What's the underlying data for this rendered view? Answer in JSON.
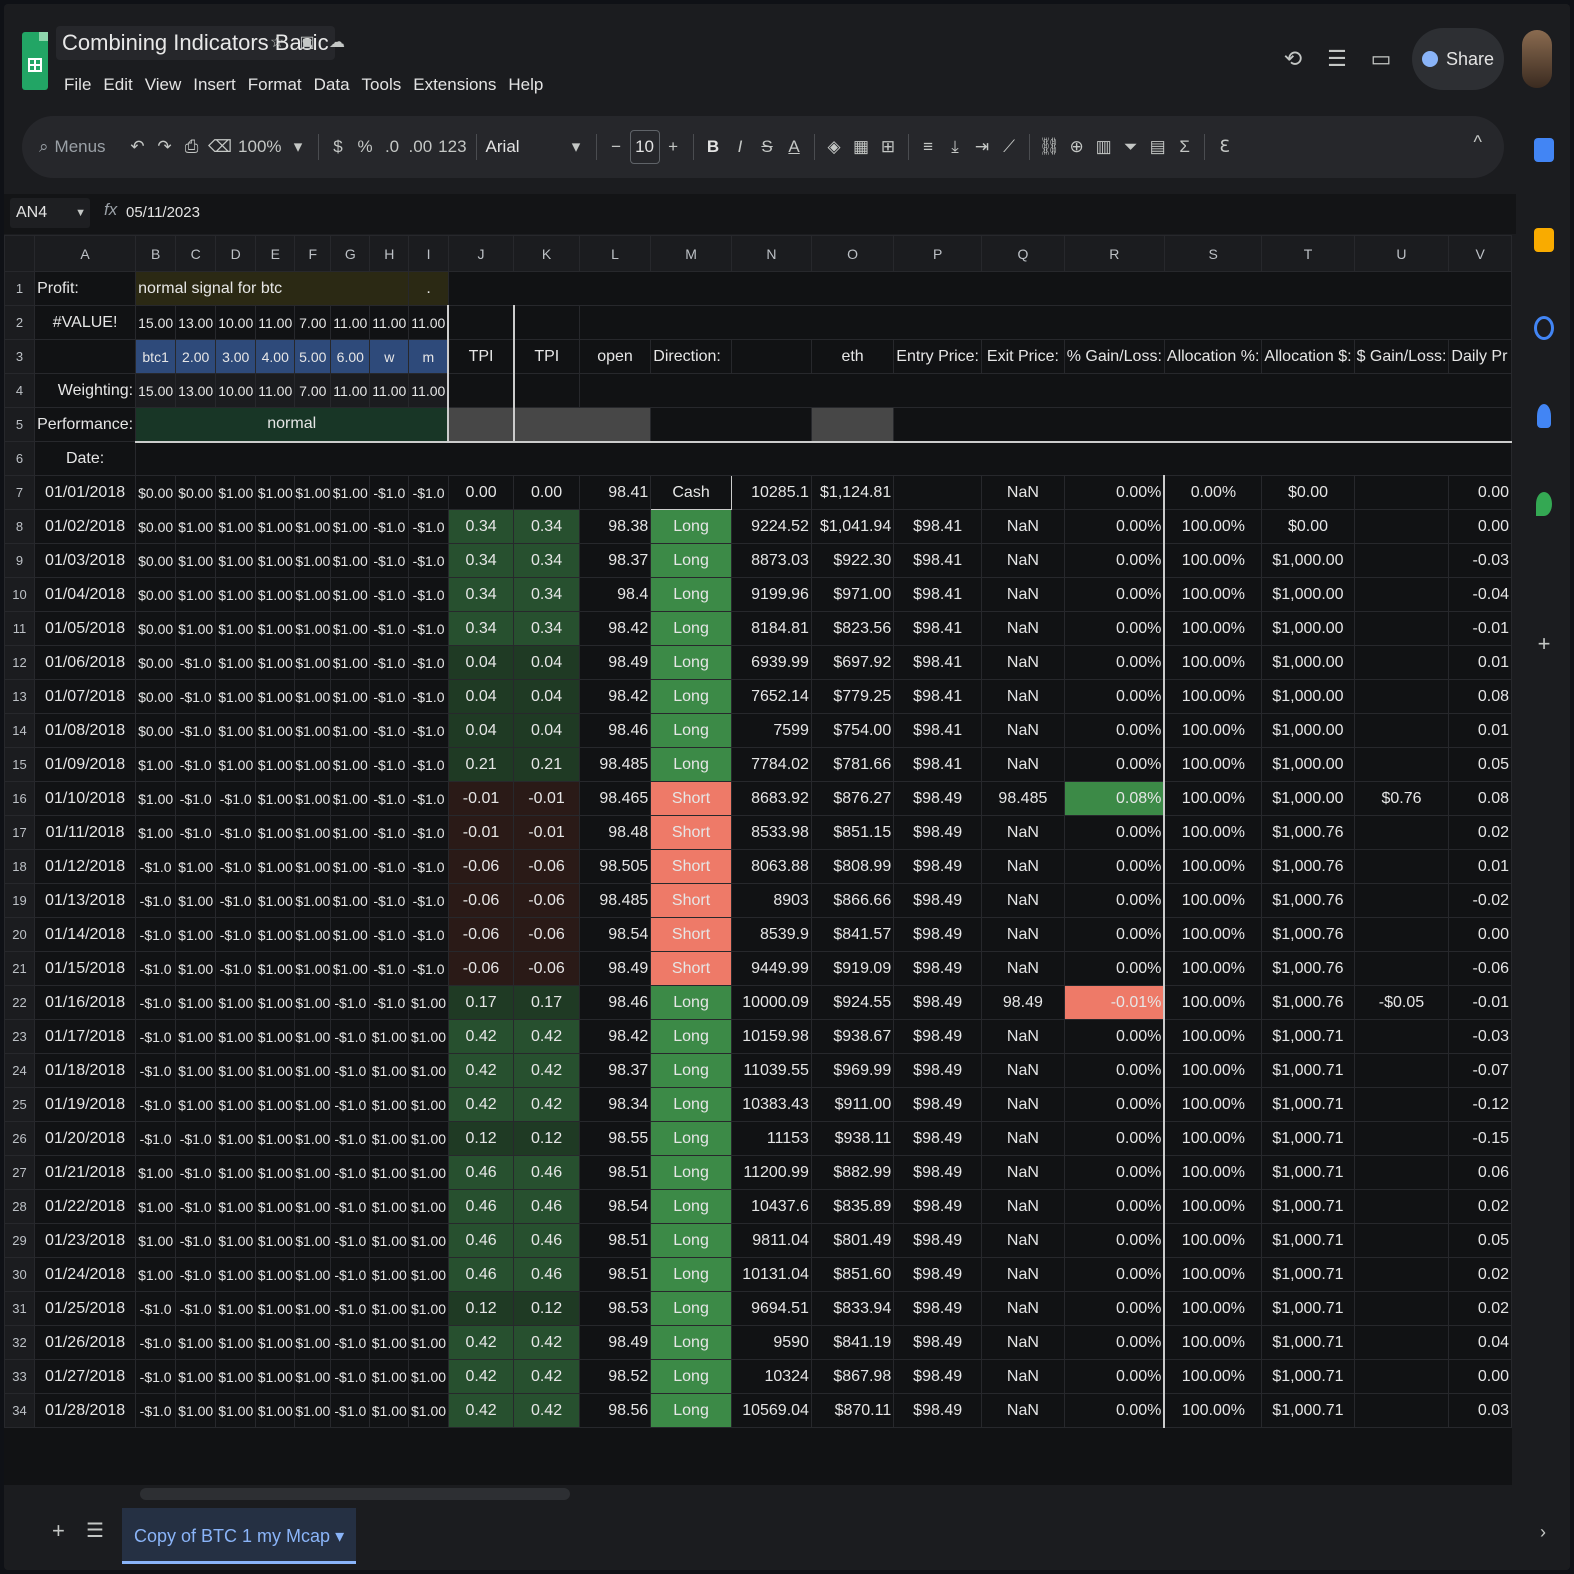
{
  "app": {
    "title": "Combining Indicators Basic",
    "menus": [
      "File",
      "Edit",
      "View",
      "Insert",
      "Format",
      "Data",
      "Tools",
      "Extensions",
      "Help"
    ],
    "share_label": "Share",
    "title_icons": [
      "star-icon",
      "move-folder-icon",
      "cloud-status-icon"
    ],
    "top_right_icons": [
      "history-icon",
      "comments-icon",
      "meet-icon"
    ]
  },
  "toolbar": {
    "search_placeholder": "Menus",
    "undo": "↶",
    "redo": "↷",
    "print": "⎙",
    "paint": "⌫",
    "zoom": "100%",
    "currency": "$",
    "percent": "%",
    "dec_less": ".0",
    "dec_more": ".00",
    "number_format": "123",
    "font": "Arial",
    "minus": "−",
    "font_size": "10",
    "plus": "+",
    "bold": "B",
    "italic": "I",
    "strike": "S",
    "text_color": "A",
    "collapse": "^"
  },
  "formula_bar": {
    "cell_ref": "AN4",
    "fx": "fx",
    "value": "05/11/2023"
  },
  "columns": [
    "A",
    "B",
    "C",
    "D",
    "E",
    "F",
    "G",
    "H",
    "I",
    "J",
    "K",
    "L",
    "M",
    "N",
    "O",
    "P",
    "Q",
    "R",
    "S",
    "T",
    "U",
    "V"
  ],
  "header_rows": {
    "r1": {
      "a": "Profit:",
      "b": "normal signal for btc",
      "i": "."
    },
    "r2": {
      "a": "#VALUE!",
      "vals": [
        "15.00",
        "13.00",
        "10.00",
        "11.00",
        "7.00",
        "11.00",
        "11.00",
        "11.00"
      ]
    },
    "r3": {
      "vals": [
        "btc1",
        "2.00",
        "3.00",
        "4.00",
        "5.00",
        "6.00",
        "w",
        "m"
      ],
      "j": "TPI",
      "k": "TPI",
      "l": "open",
      "m": "Direction:",
      "o": "eth",
      "p": "Entry Price:",
      "q": "Exit Price:",
      "r": "% Gain/Loss:",
      "s": "Allocation %:",
      "t": "Allocation $:",
      "u": "$ Gain/Loss:",
      "v": "Daily Pr"
    },
    "r4": {
      "a": "Weighting:",
      "vals": [
        "15.00",
        "13.00",
        "10.00",
        "11.00",
        "7.00",
        "11.00",
        "11.00",
        "11.00"
      ]
    },
    "r5": {
      "a": "Performance:",
      "b": "normal"
    },
    "r6": {
      "a": "Date:"
    }
  },
  "rows": [
    {
      "n": "7",
      "date": "01/01/2018",
      "sig": [
        "$0.00",
        "$0.00",
        "$1.00",
        "$1.00",
        "$1.00",
        "$1.00",
        "-$1.0",
        "-$1.0"
      ],
      "j": "0.00",
      "k": "0.00",
      "l": "98.41",
      "m": "Cash",
      "n2": "10285.1",
      "o": "$1,124.81",
      "p": "",
      "q": "NaN",
      "r": "0.00%",
      "s": "0.00%",
      "t": "$0.00",
      "u": "",
      "v": "0.00"
    },
    {
      "n": "8",
      "date": "01/02/2018",
      "sig": [
        "$0.00",
        "$1.00",
        "$1.00",
        "$1.00",
        "$1.00",
        "$1.00",
        "-$1.0",
        "-$1.0"
      ],
      "j": "0.34",
      "k": "0.34",
      "l": "98.38",
      "m": "Long",
      "n2": "9224.52",
      "o": "$1,041.94",
      "p": "$98.41",
      "q": "NaN",
      "r": "0.00%",
      "s": "100.00%",
      "t": "$0.00",
      "u": "",
      "v": "0.00"
    },
    {
      "n": "9",
      "date": "01/03/2018",
      "sig": [
        "$0.00",
        "$1.00",
        "$1.00",
        "$1.00",
        "$1.00",
        "$1.00",
        "-$1.0",
        "-$1.0"
      ],
      "j": "0.34",
      "k": "0.34",
      "l": "98.37",
      "m": "Long",
      "n2": "8873.03",
      "o": "$922.30",
      "p": "$98.41",
      "q": "NaN",
      "r": "0.00%",
      "s": "100.00%",
      "t": "$1,000.00",
      "u": "",
      "v": "-0.03"
    },
    {
      "n": "10",
      "date": "01/04/2018",
      "sig": [
        "$0.00",
        "$1.00",
        "$1.00",
        "$1.00",
        "$1.00",
        "$1.00",
        "-$1.0",
        "-$1.0"
      ],
      "j": "0.34",
      "k": "0.34",
      "l": "98.4",
      "m": "Long",
      "n2": "9199.96",
      "o": "$971.00",
      "p": "$98.41",
      "q": "NaN",
      "r": "0.00%",
      "s": "100.00%",
      "t": "$1,000.00",
      "u": "",
      "v": "-0.04"
    },
    {
      "n": "11",
      "date": "01/05/2018",
      "sig": [
        "$0.00",
        "$1.00",
        "$1.00",
        "$1.00",
        "$1.00",
        "$1.00",
        "-$1.0",
        "-$1.0"
      ],
      "j": "0.34",
      "k": "0.34",
      "l": "98.42",
      "m": "Long",
      "n2": "8184.81",
      "o": "$823.56",
      "p": "$98.41",
      "q": "NaN",
      "r": "0.00%",
      "s": "100.00%",
      "t": "$1,000.00",
      "u": "",
      "v": "-0.01"
    },
    {
      "n": "12",
      "date": "01/06/2018",
      "sig": [
        "$0.00",
        "-$1.0",
        "$1.00",
        "$1.00",
        "$1.00",
        "$1.00",
        "-$1.0",
        "-$1.0"
      ],
      "j": "0.04",
      "k": "0.04",
      "l": "98.49",
      "m": "Long",
      "n2": "6939.99",
      "o": "$697.92",
      "p": "$98.41",
      "q": "NaN",
      "r": "0.00%",
      "s": "100.00%",
      "t": "$1,000.00",
      "u": "",
      "v": "0.01"
    },
    {
      "n": "13",
      "date": "01/07/2018",
      "sig": [
        "$0.00",
        "-$1.0",
        "$1.00",
        "$1.00",
        "$1.00",
        "$1.00",
        "-$1.0",
        "-$1.0"
      ],
      "j": "0.04",
      "k": "0.04",
      "l": "98.42",
      "m": "Long",
      "n2": "7652.14",
      "o": "$779.25",
      "p": "$98.41",
      "q": "NaN",
      "r": "0.00%",
      "s": "100.00%",
      "t": "$1,000.00",
      "u": "",
      "v": "0.08"
    },
    {
      "n": "14",
      "date": "01/08/2018",
      "sig": [
        "$0.00",
        "-$1.0",
        "$1.00",
        "$1.00",
        "$1.00",
        "$1.00",
        "-$1.0",
        "-$1.0"
      ],
      "j": "0.04",
      "k": "0.04",
      "l": "98.46",
      "m": "Long",
      "n2": "7599",
      "o": "$754.00",
      "p": "$98.41",
      "q": "NaN",
      "r": "0.00%",
      "s": "100.00%",
      "t": "$1,000.00",
      "u": "",
      "v": "0.01"
    },
    {
      "n": "15",
      "date": "01/09/2018",
      "sig": [
        "$1.00",
        "-$1.0",
        "$1.00",
        "$1.00",
        "$1.00",
        "$1.00",
        "-$1.0",
        "-$1.0"
      ],
      "j": "0.21",
      "k": "0.21",
      "l": "98.485",
      "m": "Long",
      "n2": "7784.02",
      "o": "$781.66",
      "p": "$98.41",
      "q": "NaN",
      "r": "0.00%",
      "s": "100.00%",
      "t": "$1,000.00",
      "u": "",
      "v": "0.05"
    },
    {
      "n": "16",
      "date": "01/10/2018",
      "sig": [
        "$1.00",
        "-$1.0",
        "-$1.0",
        "$1.00",
        "$1.00",
        "$1.00",
        "-$1.0",
        "-$1.0"
      ],
      "j": "-0.01",
      "k": "-0.01",
      "l": "98.465",
      "m": "Short",
      "n2": "8683.92",
      "o": "$876.27",
      "p": "$98.49",
      "q": "98.485",
      "r": "0.08%",
      "s": "100.00%",
      "t": "$1,000.00",
      "u": "$0.76",
      "v": "0.08"
    },
    {
      "n": "17",
      "date": "01/11/2018",
      "sig": [
        "$1.00",
        "-$1.0",
        "-$1.0",
        "$1.00",
        "$1.00",
        "$1.00",
        "-$1.0",
        "-$1.0"
      ],
      "j": "-0.01",
      "k": "-0.01",
      "l": "98.48",
      "m": "Short",
      "n2": "8533.98",
      "o": "$851.15",
      "p": "$98.49",
      "q": "NaN",
      "r": "0.00%",
      "s": "100.00%",
      "t": "$1,000.76",
      "u": "",
      "v": "0.02"
    },
    {
      "n": "18",
      "date": "01/12/2018",
      "sig": [
        "-$1.0",
        "$1.00",
        "-$1.0",
        "$1.00",
        "$1.00",
        "$1.00",
        "-$1.0",
        "-$1.0"
      ],
      "j": "-0.06",
      "k": "-0.06",
      "l": "98.505",
      "m": "Short",
      "n2": "8063.88",
      "o": "$808.99",
      "p": "$98.49",
      "q": "NaN",
      "r": "0.00%",
      "s": "100.00%",
      "t": "$1,000.76",
      "u": "",
      "v": "0.01"
    },
    {
      "n": "19",
      "date": "01/13/2018",
      "sig": [
        "-$1.0",
        "$1.00",
        "-$1.0",
        "$1.00",
        "$1.00",
        "$1.00",
        "-$1.0",
        "-$1.0"
      ],
      "j": "-0.06",
      "k": "-0.06",
      "l": "98.485",
      "m": "Short",
      "n2": "8903",
      "o": "$866.66",
      "p": "$98.49",
      "q": "NaN",
      "r": "0.00%",
      "s": "100.00%",
      "t": "$1,000.76",
      "u": "",
      "v": "-0.02"
    },
    {
      "n": "20",
      "date": "01/14/2018",
      "sig": [
        "-$1.0",
        "$1.00",
        "-$1.0",
        "$1.00",
        "$1.00",
        "$1.00",
        "-$1.0",
        "-$1.0"
      ],
      "j": "-0.06",
      "k": "-0.06",
      "l": "98.54",
      "m": "Short",
      "n2": "8539.9",
      "o": "$841.57",
      "p": "$98.49",
      "q": "NaN",
      "r": "0.00%",
      "s": "100.00%",
      "t": "$1,000.76",
      "u": "",
      "v": "0.00"
    },
    {
      "n": "21",
      "date": "01/15/2018",
      "sig": [
        "-$1.0",
        "$1.00",
        "-$1.0",
        "$1.00",
        "$1.00",
        "$1.00",
        "-$1.0",
        "-$1.0"
      ],
      "j": "-0.06",
      "k": "-0.06",
      "l": "98.49",
      "m": "Short",
      "n2": "9449.99",
      "o": "$919.09",
      "p": "$98.49",
      "q": "NaN",
      "r": "0.00%",
      "s": "100.00%",
      "t": "$1,000.76",
      "u": "",
      "v": "-0.06"
    },
    {
      "n": "22",
      "date": "01/16/2018",
      "sig": [
        "-$1.0",
        "$1.00",
        "$1.00",
        "$1.00",
        "$1.00",
        "-$1.0",
        "-$1.0",
        "$1.00"
      ],
      "j": "0.17",
      "k": "0.17",
      "l": "98.46",
      "m": "Long",
      "n2": "10000.09",
      "o": "$924.55",
      "p": "$98.49",
      "q": "98.49",
      "r": "-0.01%",
      "s": "100.00%",
      "t": "$1,000.76",
      "u": "-$0.05",
      "v": "-0.01"
    },
    {
      "n": "23",
      "date": "01/17/2018",
      "sig": [
        "-$1.0",
        "$1.00",
        "$1.00",
        "$1.00",
        "$1.00",
        "-$1.0",
        "$1.00",
        "$1.00"
      ],
      "j": "0.42",
      "k": "0.42",
      "l": "98.42",
      "m": "Long",
      "n2": "10159.98",
      "o": "$938.67",
      "p": "$98.49",
      "q": "NaN",
      "r": "0.00%",
      "s": "100.00%",
      "t": "$1,000.71",
      "u": "",
      "v": "-0.03"
    },
    {
      "n": "24",
      "date": "01/18/2018",
      "sig": [
        "-$1.0",
        "$1.00",
        "$1.00",
        "$1.00",
        "$1.00",
        "-$1.0",
        "$1.00",
        "$1.00"
      ],
      "j": "0.42",
      "k": "0.42",
      "l": "98.37",
      "m": "Long",
      "n2": "11039.55",
      "o": "$969.99",
      "p": "$98.49",
      "q": "NaN",
      "r": "0.00%",
      "s": "100.00%",
      "t": "$1,000.71",
      "u": "",
      "v": "-0.07"
    },
    {
      "n": "25",
      "date": "01/19/2018",
      "sig": [
        "-$1.0",
        "$1.00",
        "$1.00",
        "$1.00",
        "$1.00",
        "-$1.0",
        "$1.00",
        "$1.00"
      ],
      "j": "0.42",
      "k": "0.42",
      "l": "98.34",
      "m": "Long",
      "n2": "10383.43",
      "o": "$911.00",
      "p": "$98.49",
      "q": "NaN",
      "r": "0.00%",
      "s": "100.00%",
      "t": "$1,000.71",
      "u": "",
      "v": "-0.12"
    },
    {
      "n": "26",
      "date": "01/20/2018",
      "sig": [
        "-$1.0",
        "-$1.0",
        "$1.00",
        "$1.00",
        "$1.00",
        "-$1.0",
        "$1.00",
        "$1.00"
      ],
      "j": "0.12",
      "k": "0.12",
      "l": "98.55",
      "m": "Long",
      "n2": "11153",
      "o": "$938.11",
      "p": "$98.49",
      "q": "NaN",
      "r": "0.00%",
      "s": "100.00%",
      "t": "$1,000.71",
      "u": "",
      "v": "-0.15"
    },
    {
      "n": "27",
      "date": "01/21/2018",
      "sig": [
        "$1.00",
        "-$1.0",
        "$1.00",
        "$1.00",
        "$1.00",
        "-$1.0",
        "$1.00",
        "$1.00"
      ],
      "j": "0.46",
      "k": "0.46",
      "l": "98.51",
      "m": "Long",
      "n2": "11200.99",
      "o": "$882.99",
      "p": "$98.49",
      "q": "NaN",
      "r": "0.00%",
      "s": "100.00%",
      "t": "$1,000.71",
      "u": "",
      "v": "0.06"
    },
    {
      "n": "28",
      "date": "01/22/2018",
      "sig": [
        "$1.00",
        "-$1.0",
        "$1.00",
        "$1.00",
        "$1.00",
        "-$1.0",
        "$1.00",
        "$1.00"
      ],
      "j": "0.46",
      "k": "0.46",
      "l": "98.54",
      "m": "Long",
      "n2": "10437.6",
      "o": "$835.89",
      "p": "$98.49",
      "q": "NaN",
      "r": "0.00%",
      "s": "100.00%",
      "t": "$1,000.71",
      "u": "",
      "v": "0.02"
    },
    {
      "n": "29",
      "date": "01/23/2018",
      "sig": [
        "$1.00",
        "-$1.0",
        "$1.00",
        "$1.00",
        "$1.00",
        "-$1.0",
        "$1.00",
        "$1.00"
      ],
      "j": "0.46",
      "k": "0.46",
      "l": "98.51",
      "m": "Long",
      "n2": "9811.04",
      "o": "$801.49",
      "p": "$98.49",
      "q": "NaN",
      "r": "0.00%",
      "s": "100.00%",
      "t": "$1,000.71",
      "u": "",
      "v": "0.05"
    },
    {
      "n": "30",
      "date": "01/24/2018",
      "sig": [
        "$1.00",
        "-$1.0",
        "$1.00",
        "$1.00",
        "$1.00",
        "-$1.0",
        "$1.00",
        "$1.00"
      ],
      "j": "0.46",
      "k": "0.46",
      "l": "98.51",
      "m": "Long",
      "n2": "10131.04",
      "o": "$851.60",
      "p": "$98.49",
      "q": "NaN",
      "r": "0.00%",
      "s": "100.00%",
      "t": "$1,000.71",
      "u": "",
      "v": "0.02"
    },
    {
      "n": "31",
      "date": "01/25/2018",
      "sig": [
        "-$1.0",
        "-$1.0",
        "$1.00",
        "$1.00",
        "$1.00",
        "-$1.0",
        "$1.00",
        "$1.00"
      ],
      "j": "0.12",
      "k": "0.12",
      "l": "98.53",
      "m": "Long",
      "n2": "9694.51",
      "o": "$833.94",
      "p": "$98.49",
      "q": "NaN",
      "r": "0.00%",
      "s": "100.00%",
      "t": "$1,000.71",
      "u": "",
      "v": "0.02"
    },
    {
      "n": "32",
      "date": "01/26/2018",
      "sig": [
        "-$1.0",
        "$1.00",
        "$1.00",
        "$1.00",
        "$1.00",
        "-$1.0",
        "$1.00",
        "$1.00"
      ],
      "j": "0.42",
      "k": "0.42",
      "l": "98.49",
      "m": "Long",
      "n2": "9590",
      "o": "$841.19",
      "p": "$98.49",
      "q": "NaN",
      "r": "0.00%",
      "s": "100.00%",
      "t": "$1,000.71",
      "u": "",
      "v": "0.04"
    },
    {
      "n": "33",
      "date": "01/27/2018",
      "sig": [
        "-$1.0",
        "$1.00",
        "$1.00",
        "$1.00",
        "$1.00",
        "-$1.0",
        "$1.00",
        "$1.00"
      ],
      "j": "0.42",
      "k": "0.42",
      "l": "98.52",
      "m": "Long",
      "n2": "10324",
      "o": "$867.98",
      "p": "$98.49",
      "q": "NaN",
      "r": "0.00%",
      "s": "100.00%",
      "t": "$1,000.71",
      "u": "",
      "v": "0.00"
    },
    {
      "n": "34",
      "date": "01/28/2018",
      "sig": [
        "-$1.0",
        "$1.00",
        "$1.00",
        "$1.00",
        "$1.00",
        "-$1.0",
        "$1.00",
        "$1.00"
      ],
      "j": "0.42",
      "k": "0.42",
      "l": "98.56",
      "m": "Long",
      "n2": "10569.04",
      "o": "$870.11",
      "p": "$98.49",
      "q": "NaN",
      "r": "0.00%",
      "s": "100.00%",
      "t": "$1,000.71",
      "u": "",
      "v": "0.03"
    }
  ],
  "sheet_tab": "Copy of BTC 1 my Mcap",
  "colors": {
    "long": "#3c8a47",
    "short": "#ee7a68",
    "tpi_pos": "#1f3a24",
    "tpi_pos_strong": "#27502f",
    "tpi_neg": "#2a1a17",
    "header_blue": "#2e4a7a",
    "header_green": "#183626",
    "header_olive": "#2b2914"
  }
}
